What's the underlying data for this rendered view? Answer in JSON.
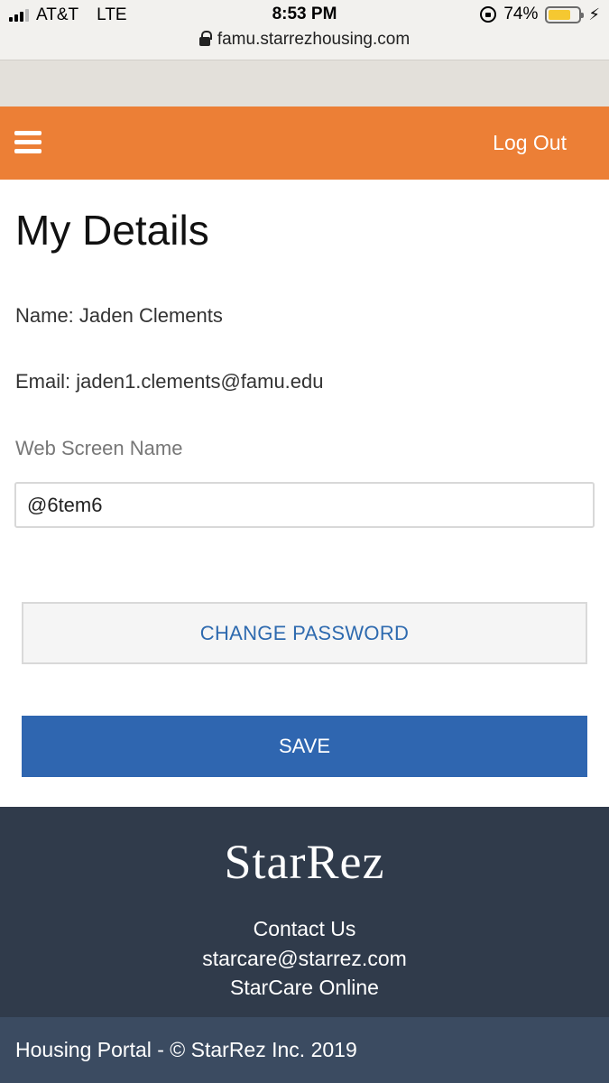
{
  "status_bar": {
    "carrier": "AT&T",
    "network": "LTE",
    "time": "8:53 PM",
    "battery_percent": "74%",
    "battery_level": 0.74,
    "url": "famu.starrezhousing.com"
  },
  "header": {
    "menu_icon": "hamburger-icon",
    "logout_label": "Log Out",
    "color": "#ec7f36"
  },
  "main": {
    "title": "My Details",
    "name_line": "Name: Jaden Clements",
    "email_line": "Email: jaden1.clements@famu.edu",
    "screen_name_label": "Web Screen Name",
    "screen_name_value": "@6tem6",
    "change_password_label": "CHANGE PASSWORD",
    "save_label": "SAVE",
    "save_color": "#2f66b0"
  },
  "footer": {
    "logo_text": "StarRez",
    "contact_label": "Contact Us",
    "email_link": "starcare@starrez.com",
    "online_link": "StarCare Online",
    "copyright": "Housing Portal - © StarRez Inc. 2019"
  }
}
